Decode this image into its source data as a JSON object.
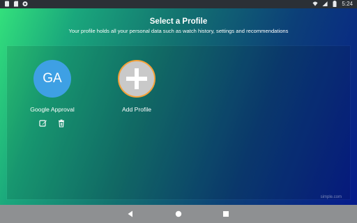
{
  "status_bar": {
    "time": "5:24",
    "left_icons": [
      "storage-icon",
      "sd-card-icon",
      "sync-icon"
    ],
    "right_icons": [
      "wifi-icon",
      "signal-icon",
      "battery-icon"
    ]
  },
  "header": {
    "title": "Select a Profile",
    "subtitle": "Your profile holds all your personal data such as watch history, settings and recommendations"
  },
  "profiles": [
    {
      "initials": "GA",
      "name": "Google Approval",
      "avatar_color": "#3ea0e4",
      "actions": [
        "edit-icon",
        "delete-icon"
      ]
    }
  ],
  "add_profile": {
    "label": "Add Profile",
    "border_color": "#f5a23a",
    "icon": "plus-icon"
  },
  "watermark": "simple.com",
  "nav_bar": {
    "buttons": [
      "back-icon",
      "home-icon",
      "recents-icon"
    ]
  },
  "colors": {
    "gradient_start": "#33e07c",
    "gradient_end": "#061b8c",
    "nav_bar": "#8e9092"
  }
}
